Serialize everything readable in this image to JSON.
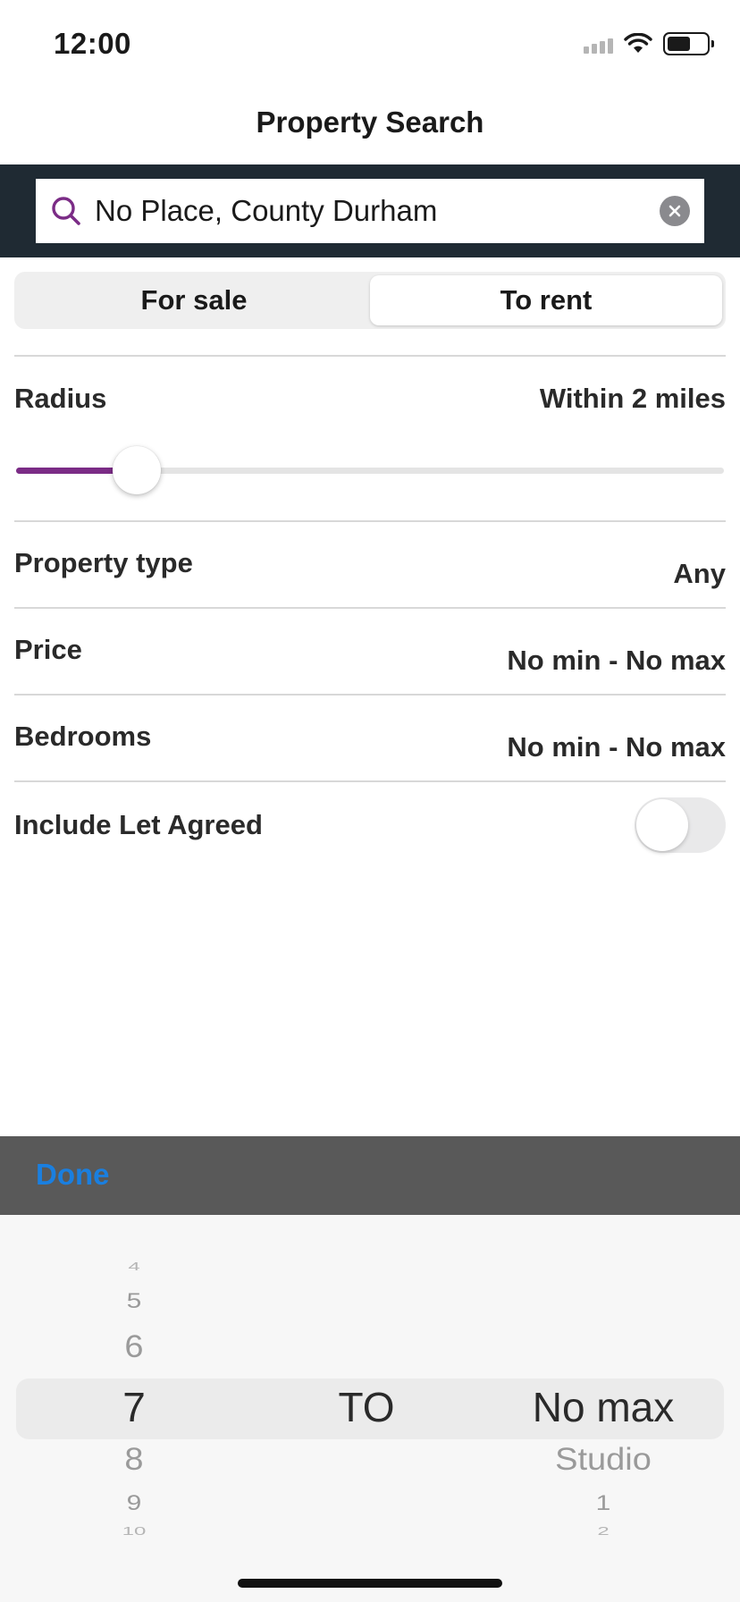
{
  "status_bar": {
    "time": "12:00"
  },
  "header": {
    "title": "Property Search"
  },
  "search": {
    "value": "No Place, County Durham"
  },
  "tabs": [
    {
      "label": "For sale",
      "active": false
    },
    {
      "label": "To rent",
      "active": true
    }
  ],
  "filters": {
    "radius": {
      "label": "Radius",
      "value": "Within 2 miles",
      "slider_fraction": 0.17
    },
    "property_type": {
      "label": "Property type",
      "value": "Any"
    },
    "price": {
      "label": "Price",
      "value": "No min - No max"
    },
    "bedrooms": {
      "label": "Bedrooms",
      "value": "No min - No max"
    },
    "include_let_agreed": {
      "label": "Include Let Agreed",
      "on": false
    }
  },
  "picker": {
    "done_label": "Done",
    "column_min": {
      "above": [
        "4",
        "5",
        "6"
      ],
      "selected": "7",
      "below": [
        "8",
        "9",
        "10"
      ]
    },
    "separator": "TO",
    "column_max": {
      "selected": "No max",
      "below": [
        "Studio",
        "1",
        "2"
      ]
    }
  },
  "colors": {
    "accent": "#7b2c86",
    "link": "#1a7fe0",
    "search_band": "#1f2a33",
    "toolbar": "#595959"
  }
}
